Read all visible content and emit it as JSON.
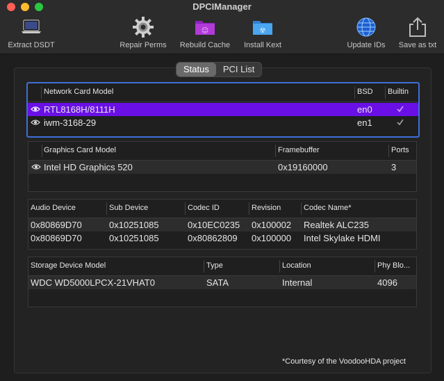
{
  "window": {
    "title": "DPCIManager"
  },
  "toolbar": [
    {
      "label": "Extract DSDT",
      "icon": "laptop-icon"
    },
    {
      "label": "Repair Perms",
      "icon": "gear-icon"
    },
    {
      "label": "Rebuild Cache",
      "icon": "purple-folder-icon"
    },
    {
      "label": "Install Kext",
      "icon": "blue-folder-icon"
    },
    {
      "label": "Update IDs",
      "icon": "globe-icon"
    },
    {
      "label": "Save as txt",
      "icon": "share-icon"
    }
  ],
  "tabs": [
    {
      "label": "Status",
      "active": true
    },
    {
      "label": "PCI List",
      "active": false
    }
  ],
  "network": {
    "headers": [
      "Network Card Model",
      "BSD",
      "Builtin"
    ],
    "rows": [
      {
        "model": "RTL8168H/8111H",
        "bsd": "en0",
        "builtin": true,
        "selected": true
      },
      {
        "model": "iwm-3168-29",
        "bsd": "en1",
        "builtin": true,
        "selected": false
      }
    ]
  },
  "graphics": {
    "headers": [
      "Graphics Card Model",
      "Framebuffer",
      "Ports"
    ],
    "rows": [
      {
        "model": "Intel HD Graphics 520",
        "framebuffer": "0x19160000",
        "ports": "3"
      }
    ]
  },
  "audio": {
    "headers": [
      "Audio Device",
      "Sub Device",
      "Codec ID",
      "Revision",
      "Codec Name*"
    ],
    "rows": [
      [
        "0x80869D70",
        "0x10251085",
        "0x10EC0235",
        "0x100002",
        "Realtek ALC235"
      ],
      [
        "0x80869D70",
        "0x10251085",
        "0x80862809",
        "0x100000",
        "Intel Skylake HDMI"
      ]
    ]
  },
  "storage": {
    "headers": [
      "Storage Device Model",
      "Type",
      "Location",
      "Phy Blo..."
    ],
    "rows": [
      [
        "WDC WD5000LPCX-21VHAT0",
        "SATA",
        "Internal",
        "4096"
      ]
    ]
  },
  "footer": "*Courtesy of the VoodooHDA project"
}
